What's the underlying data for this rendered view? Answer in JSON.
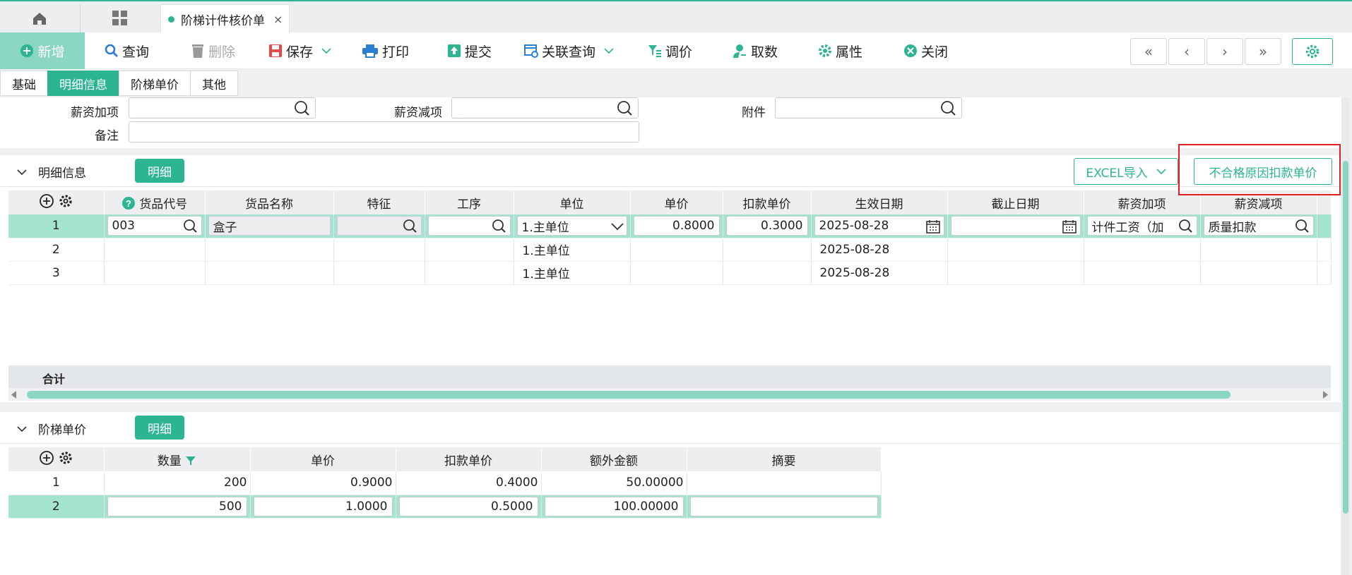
{
  "tabbar": {
    "active_tab": "阶梯计件核价单",
    "close": "×"
  },
  "toolbar": {
    "new": "新增",
    "query": "查询",
    "delete": "删除",
    "save": "保存",
    "print": "打印",
    "submit": "提交",
    "related_query": "关联查询",
    "adjust_price": "调价",
    "fetch": "取数",
    "properties": "属性",
    "close": "关闭",
    "nav": [
      "«",
      "‹",
      "›",
      "»"
    ]
  },
  "subtabs": [
    "基础",
    "明细信息",
    "阶梯单价",
    "其他"
  ],
  "form": {
    "salary_add_label": "薪资加项",
    "salary_sub_label": "薪资减项",
    "attachment_label": "附件",
    "remark_label": "备注"
  },
  "detail_section": {
    "title": "明细信息",
    "pill": "明细",
    "excel_import": "EXCEL导入",
    "unqualified_btn": "不合格原因扣款单价",
    "columns": [
      "货品代号",
      "货品名称",
      "特征",
      "工序",
      "单位",
      "单价",
      "扣款单价",
      "生效日期",
      "截止日期",
      "薪资加项",
      "薪资减项"
    ],
    "rows": [
      {
        "no": "1",
        "code": "003",
        "name": "盒子",
        "feature": "",
        "process": "",
        "unit": "1.主单位",
        "price": "0.8000",
        "deduct": "0.3000",
        "start": "2025-08-28",
        "end": "",
        "add": "计件工资（加",
        "sub": "质量扣款"
      },
      {
        "no": "2",
        "code": "",
        "name": "",
        "feature": "",
        "process": "",
        "unit": "1.主单位",
        "price": "",
        "deduct": "",
        "start": "2025-08-28",
        "end": "",
        "add": "",
        "sub": ""
      },
      {
        "no": "3",
        "code": "",
        "name": "",
        "feature": "",
        "process": "",
        "unit": "1.主单位",
        "price": "",
        "deduct": "",
        "start": "2025-08-28",
        "end": "",
        "add": "",
        "sub": ""
      }
    ],
    "sum_label": "合计"
  },
  "ladder_section": {
    "title": "阶梯单价",
    "pill": "明细",
    "columns": [
      "数量",
      "单价",
      "扣款单价",
      "额外金额",
      "摘要"
    ],
    "rows": [
      {
        "no": "1",
        "qty": "200",
        "price": "0.9000",
        "deduct": "0.4000",
        "extra": "50.00000",
        "memo": ""
      },
      {
        "no": "2",
        "qty": "500",
        "price": "1.0000",
        "deduct": "0.5000",
        "extra": "100.00000",
        "memo": ""
      }
    ]
  },
  "colors": {
    "accent": "#2db492",
    "accent_light": "#8ad6c2",
    "selected_row": "#a5e3d1",
    "highlight_box": "#e02020"
  }
}
